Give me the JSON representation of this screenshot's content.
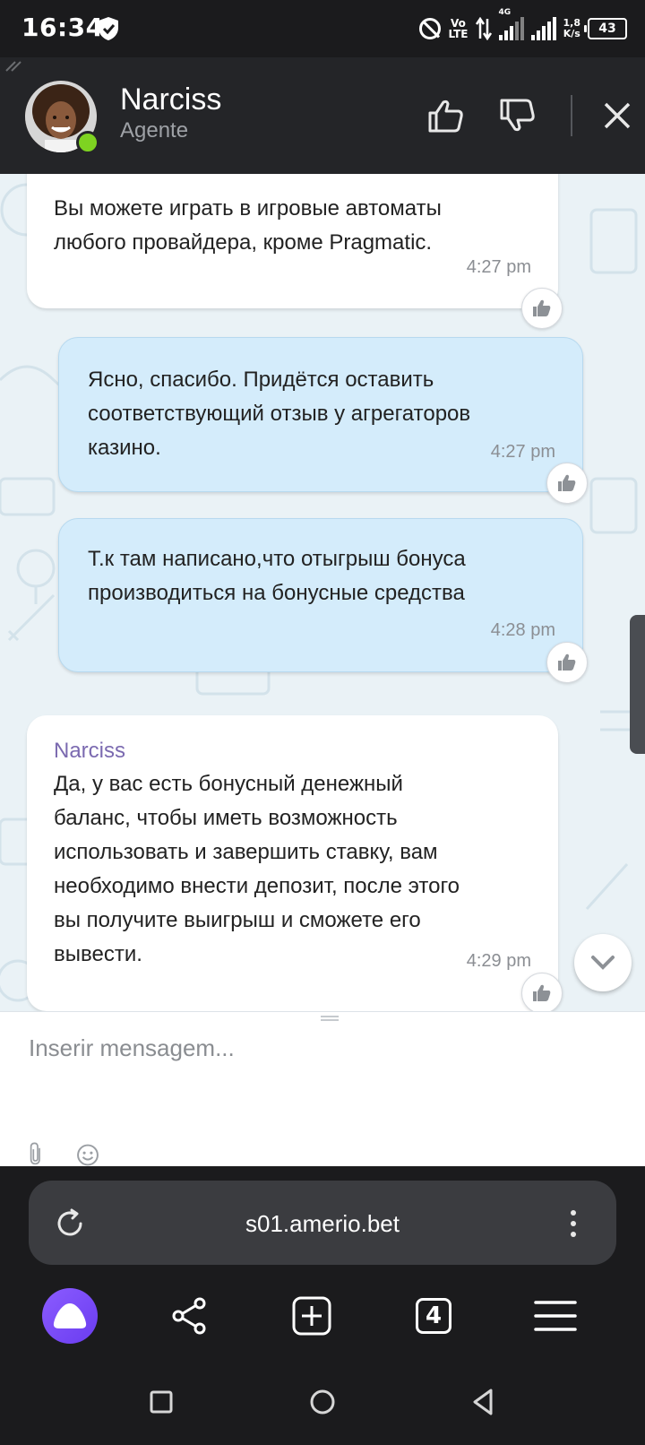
{
  "status_bar": {
    "time": "16:34",
    "network": "4G",
    "volte_line1": "Vo",
    "volte_line2": "LTE",
    "speed_value": "1,8",
    "speed_unit": "K/s",
    "battery": "43"
  },
  "header": {
    "agent_name": "Narciss",
    "agent_role": "Agente",
    "status_color": "#7ed321"
  },
  "messages": [
    {
      "direction": "incoming",
      "text": "Вы можете играть в игровые автоматы\nлюбого провайдера, кроме Pragmatic.",
      "time": "4:27 pm"
    },
    {
      "direction": "outgoing",
      "text": "Ясно, спасибо. Придётся оставить\nсоответствующий отзыв у агрегаторов\nказино.",
      "time": "4:27 pm"
    },
    {
      "direction": "outgoing",
      "text": "Т.к там написано,что отыгрыш бонуса\nпроизводиться на бонусные средства",
      "time": "4:28 pm"
    },
    {
      "direction": "incoming",
      "sender": "Narciss",
      "text": "Да, у вас есть бонусный денежный\nбаланс, чтобы иметь возможность\nиспользовать и завершить ставку, вам\nнеобходимо внести депозит, после этого\nвы получите выигрыш и сможете его\nвывести.",
      "time": "4:29 pm"
    }
  ],
  "composer": {
    "placeholder": "Inserir mensagem..."
  },
  "browser": {
    "url": "s01.amerio.bet",
    "tabs_count": "4"
  },
  "colors": {
    "outgoing_bubble": "#d4ecfb",
    "incoming_bubble": "#ffffff",
    "sender_name": "#7b6ab0",
    "alice_accent": "#7a4cff"
  }
}
